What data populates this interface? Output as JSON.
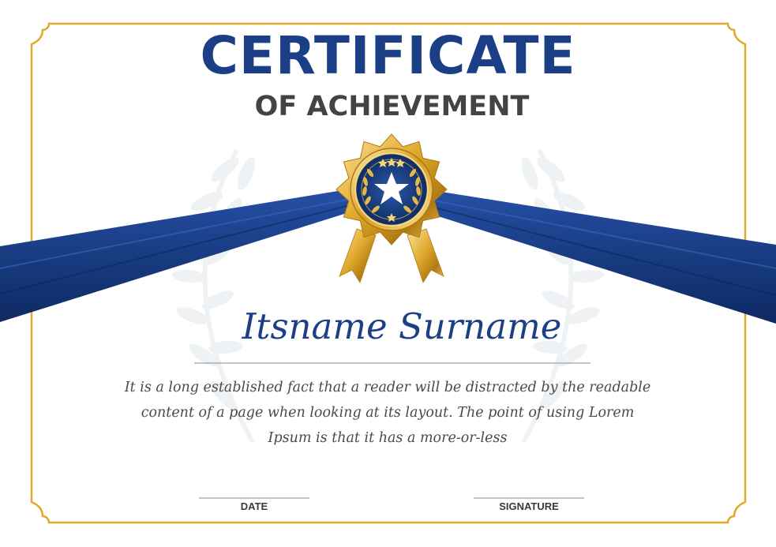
{
  "certificate": {
    "title": "CERTIFICATE",
    "subtitle": "OF ACHIEVEMENT",
    "recipient_name": "Itsname Surname",
    "body_text": "It is a long established fact that a reader will be distracted by the readable content of a page when looking at its layout. The point of using Lorem Ipsum is that it has a more-or-less",
    "date_label": "DATE",
    "signature_label": "SIGNATURE"
  },
  "colors": {
    "navy": "#1b3f86",
    "gold": "#e0a92c",
    "heading_gray": "#434343",
    "text_gray": "#4a4a4a"
  },
  "icons": [
    "gold-seal-badge",
    "star-icon",
    "laurel-wreath",
    "blue-ribbon"
  ]
}
